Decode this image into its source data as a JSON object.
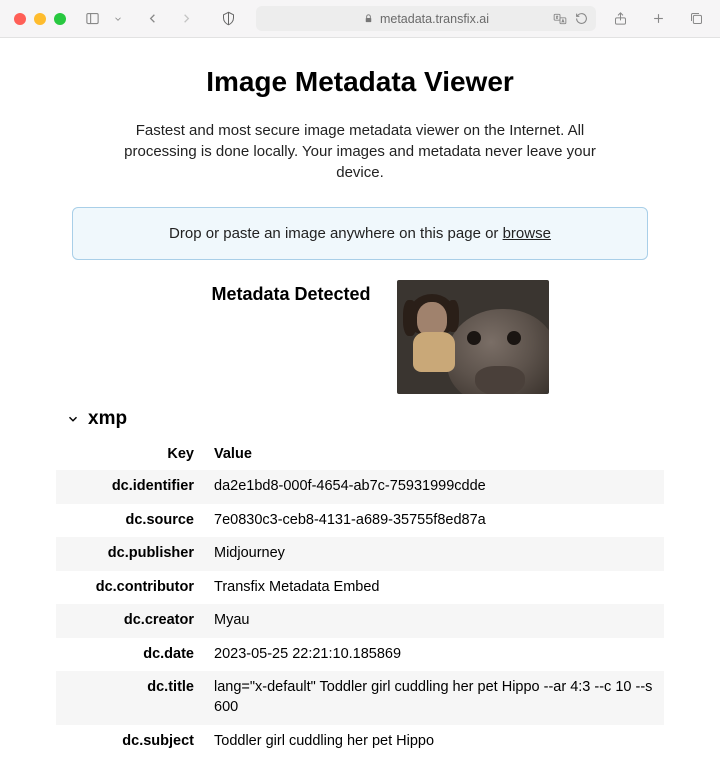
{
  "browser": {
    "url_host": "metadata.transfix.ai"
  },
  "page": {
    "title": "Image Metadata Viewer",
    "subtitle": "Fastest and most secure image metadata viewer on the Internet. All processing is done locally. Your images and metadata never leave your device.",
    "dropzone_prefix": "Drop or paste an image anywhere on this page or ",
    "dropzone_link": "browse",
    "detected_title": "Metadata Detected"
  },
  "section": {
    "name": "xmp",
    "headers": {
      "key": "Key",
      "value": "Value"
    },
    "rows": [
      {
        "key": "dc.identifier",
        "value": "da2e1bd8-000f-4654-ab7c-75931999cdde"
      },
      {
        "key": "dc.source",
        "value": "7e0830c3-ceb8-4131-a689-35755f8ed87a"
      },
      {
        "key": "dc.publisher",
        "value": "Midjourney"
      },
      {
        "key": "dc.contributor",
        "value": "Transfix Metadata Embed"
      },
      {
        "key": "dc.creator",
        "value": "Myau"
      },
      {
        "key": "dc.date",
        "value": "2023-05-25 22:21:10.185869"
      },
      {
        "key": "dc.title",
        "value": "lang=\"x-default\" Toddler girl cuddling her pet Hippo --ar 4:3 --c 10 --s 600"
      },
      {
        "key": "dc.subject",
        "value": "Toddler girl cuddling her pet Hippo"
      }
    ]
  }
}
